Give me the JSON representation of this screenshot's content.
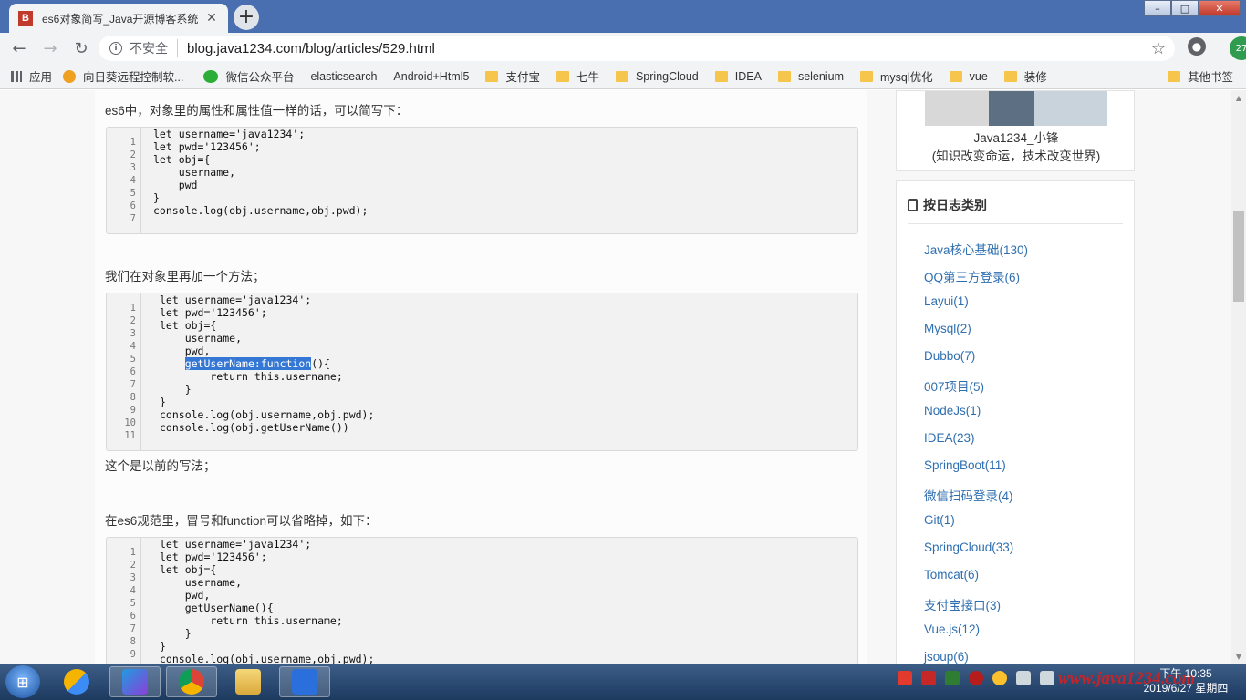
{
  "tab": {
    "title": "es6对象简写_Java开源博客系统",
    "favicon": "B",
    "close": "✕",
    "new_tab": "+"
  },
  "window": {
    "minimize": "–",
    "maximize": "□",
    "close": "✕"
  },
  "address": {
    "insecure": "不安全",
    "url": "blog.java1234.com/blog/articles/529.html",
    "ext_badge": "27"
  },
  "bookmarks": {
    "items": [
      "应用",
      "向日葵远程控制软...",
      "微信公众平台",
      "elasticsearch",
      "Android+Html5",
      "支付宝",
      "七牛",
      "SpringCloud",
      "IDEA",
      "selenium",
      "mysql优化",
      "vue",
      "装修"
    ],
    "other": "其他书签"
  },
  "article": {
    "p1": "es6中，对象里的属性和属性值一样的话，可以简写下：",
    "code1": [
      "let username='java1234';",
      "let pwd='123456';",
      "let obj={",
      "    username,",
      "    pwd",
      "}",
      "console.log(obj.username,obj.pwd);",
      ""
    ],
    "p2": "我们在对象里再加一个方法；",
    "code2": [
      "let username='java1234';",
      "let pwd='123456';",
      "let obj={",
      "    username,",
      "    pwd,",
      "",
      "        return this.username;",
      "    }",
      "}",
      "console.log(obj.username,obj.pwd);",
      "console.log(obj.getUserName())",
      ""
    ],
    "code2_line6_indent": "    ",
    "code2_line6_selected": "getUserName:function",
    "code2_line6_rest": "(){",
    "p3": "这个是以前的写法；",
    "p4": "在es6规范里，冒号和function可以省略掉，如下：",
    "code3": [
      "let username='java1234';",
      "let pwd='123456';",
      "let obj={",
      "    username,",
      "    pwd,",
      "    getUserName(){",
      "        return this.username;",
      "    }",
      "}",
      "console.log(obj.username,obj.pwd);"
    ]
  },
  "sidebar": {
    "profile_name": "Java1234_小锋",
    "profile_motto": "(知识改变命运，技术改变世界)",
    "categories_title": "按日志类别",
    "categories": [
      "Java核心基础(130)",
      "QQ第三方登录(6)",
      "Layui(1)",
      "Mysql(2)",
      "Dubbo(7)",
      "007项目(5)",
      "NodeJs(1)",
      "IDEA(23)",
      "SpringBoot(11)",
      "微信扫码登录(4)",
      "Git(1)",
      "SpringCloud(33)",
      "Tomcat(6)",
      "支付宝接口(3)",
      "Vue.js(12)",
      "jsoup(6)"
    ]
  },
  "taskbar": {
    "time": "下午 10:35",
    "date": "2019/6/27 星期四",
    "watermark": "www.java1234.com"
  },
  "colors": {
    "link": "#2f6fb0",
    "selection": "#3477d4",
    "tab_bar": "#4a6fb0"
  }
}
